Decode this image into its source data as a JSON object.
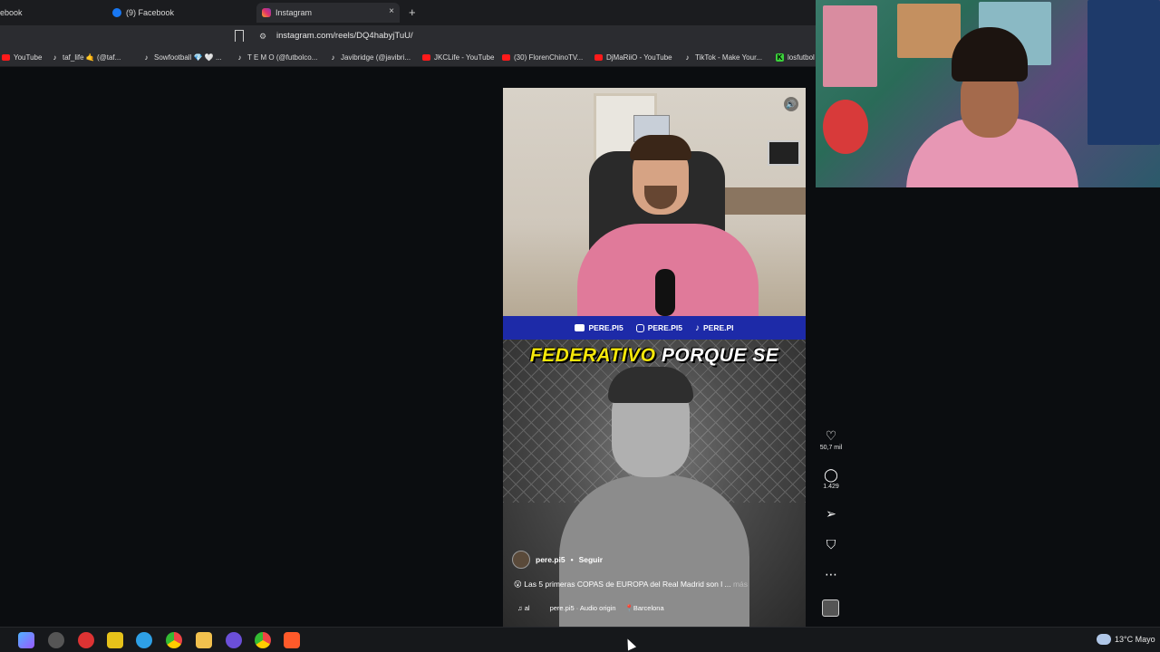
{
  "browser": {
    "tabs": [
      {
        "label": "ebook",
        "favicon": "facebook-icon",
        "active": false
      },
      {
        "label": "(9) Facebook",
        "favicon": "facebook-icon",
        "active": false
      },
      {
        "label": "Instagram",
        "favicon": "instagram-icon",
        "active": true
      }
    ],
    "tab_close": "×",
    "new_tab": "+",
    "url": "instagram.com/reels/DQ4habyjTuU/",
    "bookmarks": [
      {
        "label": "YouTube",
        "icon": "youtube-icon"
      },
      {
        "label": "taf_life 🤙 (@taf...",
        "icon": "tiktok-icon"
      },
      {
        "label": "Sowfootball 💎 🤍 ...",
        "icon": "tiktok-icon"
      },
      {
        "label": "T E M O (@futbolco...",
        "icon": "tiktok-icon"
      },
      {
        "label": "Javibridge (@javibri...",
        "icon": "tiktok-icon"
      },
      {
        "label": "JKCLife - YouTube",
        "icon": "youtube-icon"
      },
      {
        "label": "(30) FlorenChinoTV...",
        "icon": "youtube-icon"
      },
      {
        "label": "DjMaRiiO - YouTube",
        "icon": "youtube-icon"
      },
      {
        "label": "TikTok - Make Your...",
        "icon": "tiktok-icon"
      },
      {
        "label": "losfutbol",
        "icon": "kick-icon"
      }
    ]
  },
  "reel": {
    "banner": [
      "PERE.PI5",
      "PERE.PI5",
      "PERE.PI"
    ],
    "caption_highlight": "FEDERATIVO",
    "caption_rest": "PORQUE SE",
    "author": "pere.pi5",
    "dot": "•",
    "follow": "Seguir",
    "description": "Las 5 primeras COPAS de EUROPA del Real Madrid son l ...",
    "description_emoji": "😮",
    "more": "más",
    "music_label": "al",
    "audio": "pere.pi5 · Audio origin",
    "location": "Barcelona"
  },
  "actions": {
    "likes": "50,7 mil",
    "comments": "1.429"
  },
  "taskbar": {
    "weather": "13°C  Mayo"
  },
  "colors": {
    "banner_blue": "#1d2aa8",
    "caption_yellow": "#f5e70a",
    "page_bg": "#0b0d10"
  }
}
